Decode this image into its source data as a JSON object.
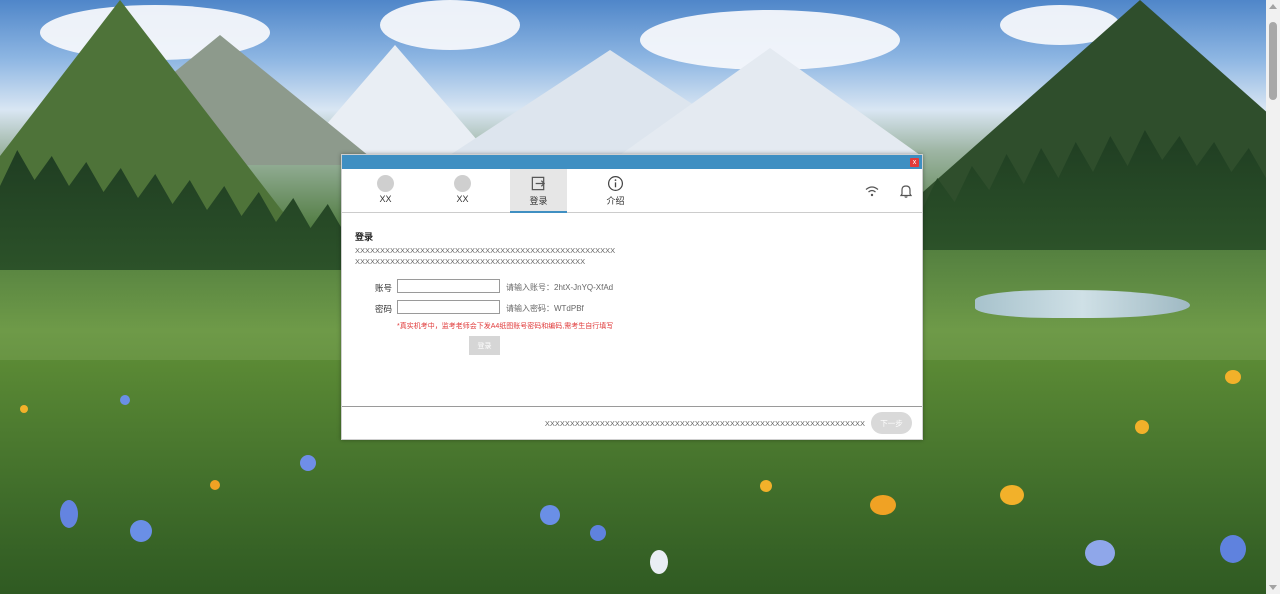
{
  "tabs": [
    {
      "label": "XX",
      "icon": "circle-icon"
    },
    {
      "label": "XX",
      "icon": "circle-icon"
    },
    {
      "label": "登录",
      "icon": "login-icon"
    },
    {
      "label": "介绍",
      "icon": "info-icon"
    }
  ],
  "status": {
    "wifi_icon": "wifi-icon",
    "bell_icon": "bell-icon"
  },
  "close_label": "x",
  "content": {
    "heading": "登录",
    "desc_line1": "XXXXXXXXXXXXXXXXXXXXXXXXXXXXXXXXXXXXXXXXXXXXXXXXXXXX",
    "desc_line2": "XXXXXXXXXXXXXXXXXXXXXXXXXXXXXXXXXXXXXXXXXXXXXX",
    "account_label": "账号",
    "account_value": "",
    "account_hint": "请输入账号：2htX-JnYQ-XfAd",
    "password_label": "密码",
    "password_value": "",
    "password_hint": "请输入密码：WTdPBf",
    "notice": "*真实机考中，监考老师会下发A4纸图账号密码和编码,需考生自行填写",
    "login_button": "登录"
  },
  "footer": {
    "text": "XXXXXXXXXXXXXXXXXXXXXXXXXXXXXXXXXXXXXXXXXXXXXXXXXXXXXXXXXXXXXXXX",
    "next_button": "下一步"
  },
  "colors": {
    "accent": "#3f8fc2",
    "notice": "#e03a3a",
    "close": "#e23b3b"
  }
}
